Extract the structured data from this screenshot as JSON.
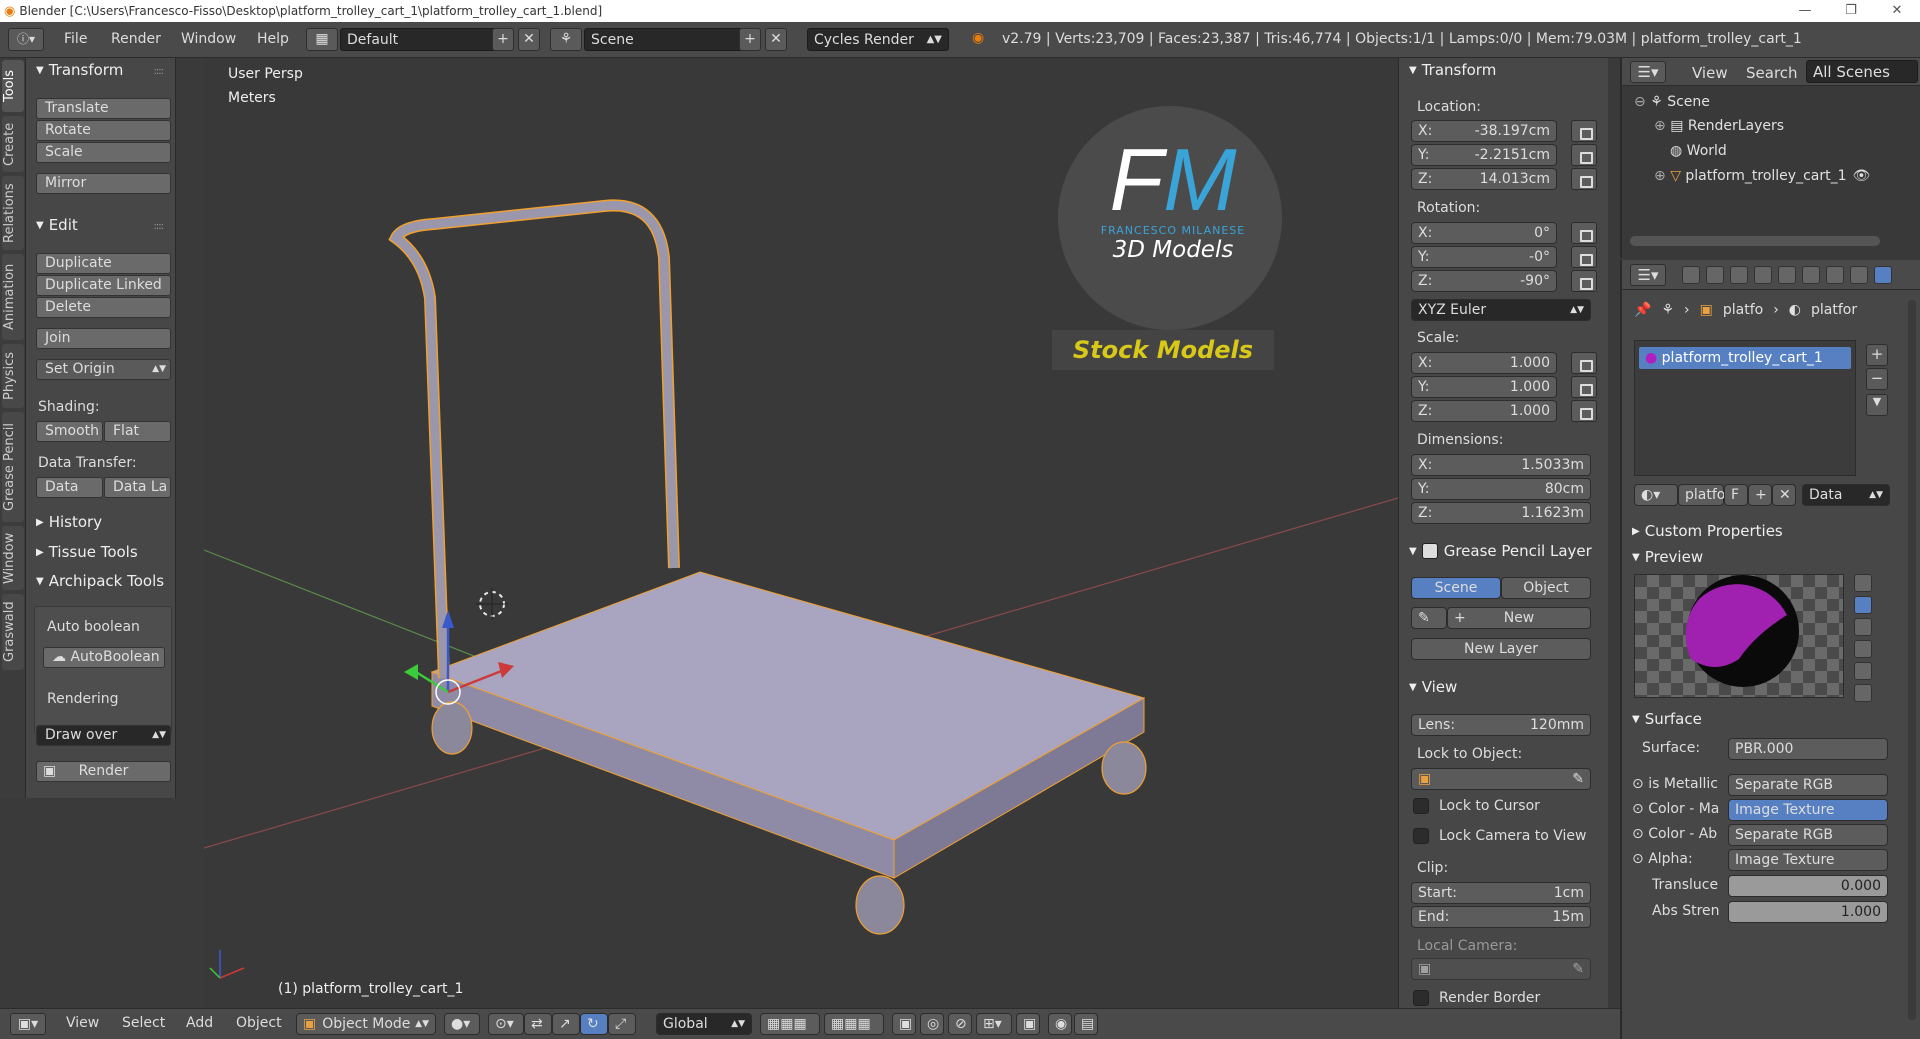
{
  "window": {
    "title": "Blender [C:\\Users\\Francesco-Fisso\\Desktop\\platform_trolley_cart_1\\platform_trolley_cart_1.blend]",
    "stats": "v2.79 | Verts:23,709 | Faces:23,387 | Tris:46,774 | Objects:1/1 | Lamps:0/0 | Mem:79.03M | platform_trolley_cart_1"
  },
  "topbar": {
    "menus": [
      "File",
      "Render",
      "Window",
      "Help"
    ],
    "screen_layout": "Default",
    "scene": "Scene",
    "render_engine": "Cycles Render"
  },
  "vertical_tabs": [
    "Tools",
    "Create",
    "Relations",
    "Animation",
    "Physics",
    "Grease Pencil",
    "Window",
    "Graswald"
  ],
  "toolshelf": {
    "transform_title": "Transform",
    "transform_buttons": [
      "Translate",
      "Rotate",
      "Scale"
    ],
    "mirror": "Mirror",
    "edit_title": "Edit",
    "edit_buttons": [
      "Duplicate",
      "Duplicate Linked",
      "Delete"
    ],
    "join": "Join",
    "set_origin": "Set Origin",
    "shading_label": "Shading:",
    "smooth": "Smooth",
    "flat": "Flat",
    "data_transfer_label": "Data Transfer:",
    "data": "Data",
    "data_la": "Data La",
    "history": "History",
    "tissue_tools": "Tissue Tools",
    "archipack": "Archipack Tools",
    "auto_boolean_label": "Auto boolean",
    "autoboolean_btn": "AutoBoolean",
    "rendering_label": "Rendering",
    "draw_over": "Draw over",
    "render_btn": "Render"
  },
  "viewport": {
    "view_name": "User Persp",
    "units": "Meters",
    "object_label": "(1) platform_trolley_cart_1",
    "logo_letters": "FM",
    "logo_name": "FRANCESCO MILANESE",
    "logo_sub": "3D Models",
    "stock": "Stock Models"
  },
  "npanel": {
    "transform_title": "Transform",
    "location_label": "Location:",
    "location": [
      {
        "axis": "X:",
        "value": "-38.197cm"
      },
      {
        "axis": "Y:",
        "value": "-2.2151cm"
      },
      {
        "axis": "Z:",
        "value": "14.013cm"
      }
    ],
    "rotation_label": "Rotation:",
    "rotation": [
      {
        "axis": "X:",
        "value": "0°"
      },
      {
        "axis": "Y:",
        "value": "-0°"
      },
      {
        "axis": "Z:",
        "value": "-90°"
      }
    ],
    "rotation_mode": "XYZ Euler",
    "scale_label": "Scale:",
    "scale": [
      {
        "axis": "X:",
        "value": "1.000"
      },
      {
        "axis": "Y:",
        "value": "1.000"
      },
      {
        "axis": "Z:",
        "value": "1.000"
      }
    ],
    "dimensions_label": "Dimensions:",
    "dimensions": [
      {
        "axis": "X:",
        "value": "1.5033m"
      },
      {
        "axis": "Y:",
        "value": "80cm"
      },
      {
        "axis": "Z:",
        "value": "1.1623m"
      }
    ],
    "grease_title": "Grease Pencil Layer",
    "scene_btn": "Scene",
    "object_btn": "Object",
    "new_btn": "New",
    "new_layer_btn": "New Layer",
    "view_title": "View",
    "lens_label": "Lens:",
    "lens_value": "120mm",
    "lock_to_object": "Lock to Object:",
    "lock_to_cursor": "Lock to Cursor",
    "lock_camera": "Lock Camera to View",
    "clip_label": "Clip:",
    "clip_start_label": "Start:",
    "clip_start": "1cm",
    "clip_end_label": "End:",
    "clip_end": "15m",
    "local_camera": "Local Camera:",
    "render_border": "Render Border"
  },
  "outliner": {
    "menus": [
      "View",
      "Search"
    ],
    "filter": "All Scenes",
    "items": [
      "Scene",
      "RenderLayers",
      "World",
      "platform_trolley_cart_1"
    ]
  },
  "properties": {
    "breadcrumb": [
      "platfo",
      "platfor"
    ],
    "material_slot": "platform_trolley_cart_1",
    "material_name": "platfo",
    "f_label": "F",
    "data_dropdown": "Data",
    "custom_props": "Custom Properties",
    "preview_title": "Preview",
    "surface_title": "Surface",
    "surface_label": "Surface:",
    "surface_value": "PBR.000",
    "inputs": [
      {
        "label": "is Metallic",
        "value": "Separate RGB"
      },
      {
        "label": "Color - Ma",
        "value": "Image Texture"
      },
      {
        "label": "Color - Ab",
        "value": "Separate RGB"
      },
      {
        "label": "Alpha:",
        "value": "Image Texture"
      }
    ],
    "translu_label": "Transluce",
    "translu_value": "0.000",
    "absstren_label": "Abs Stren",
    "absstren_value": "1.000"
  },
  "bottombar": {
    "menus": [
      "View",
      "Select",
      "Add",
      "Object"
    ],
    "mode": "Object Mode",
    "orientation": "Global"
  },
  "colors": {
    "accent_blue": "#5680c2",
    "selection_orange": "#f0a030",
    "logo_blue": "#3aa4d8",
    "stock_yellow": "#d8c818"
  }
}
